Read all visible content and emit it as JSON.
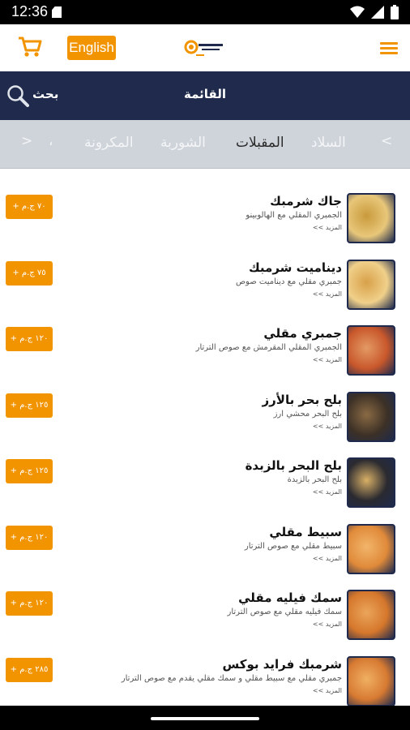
{
  "status": {
    "time": "12:36"
  },
  "header": {
    "language_label": "English",
    "logo_text": "شرمبكس"
  },
  "search": {
    "label": "بحث",
    "title": "القائمة"
  },
  "categories": {
    "left_arrow": ">",
    "right_arrow": "<",
    "dot": "،",
    "items": [
      "المكرونة",
      "الشوربة",
      "المقبلات",
      "السلاد"
    ],
    "active_index": 2
  },
  "menu_items": [
    {
      "name": "جاك شرمبك",
      "desc": "الجمبري المقلي مع الهالوبينو",
      "more": "المزيد >>",
      "price": "٧٠ ج.م +",
      "colors": [
        "#e8c77a",
        "#c99a3c"
      ]
    },
    {
      "name": "ديناميت شرمبك",
      "desc": "جمبري مقلي مع ديناميت صوص",
      "more": "المزيد >>",
      "price": "٧٥ ج.م +",
      "colors": [
        "#f0d08a",
        "#d8a14a"
      ]
    },
    {
      "name": "جمبري مقلي",
      "desc": "الجمبري المقلي المقرمش مع صوص الترتار",
      "more": "المزيد >>",
      "price": "١٢٠ ج.م +",
      "colors": [
        "#c9582c",
        "#e39a64"
      ]
    },
    {
      "name": "بلح بحر بالأرز",
      "desc": "بلح البحر محشي ارز",
      "more": "المزيد >>",
      "price": "١٢٥ ج.م +",
      "colors": [
        "#3d3126",
        "#8a6a44"
      ]
    },
    {
      "name": "بلح البحر بالزبدة",
      "desc": "بلح البحر بالزبدة",
      "more": "المزيد >>",
      "price": "١٢٥ ج.م +",
      "colors": [
        "#2a2a30",
        "#d9b066"
      ]
    },
    {
      "name": "سبيط مقلي",
      "desc": "سبيط مقلي مع صوص الترتار",
      "more": "المزيد >>",
      "price": "١٢٠ ج.م +",
      "colors": [
        "#e08a3a",
        "#f2b56a"
      ]
    },
    {
      "name": "سمك فيليه مقلي",
      "desc": "سمك فيليه مقلي مع صوص الترتار",
      "more": "المزيد >>",
      "price": "١٢٠ ج.م +",
      "colors": [
        "#d5772c",
        "#eaa55a"
      ]
    },
    {
      "name": "شرمبك فرايد بوكس",
      "desc": "جمبري مقلي مع سبيط مقلي و سمك مقلي يقدم مع صوص الترتار",
      "more": "المزيد >>",
      "price": "٢٨٥ ج.م +",
      "colors": [
        "#d77a32",
        "#f0b062"
      ]
    }
  ],
  "colors": {
    "accent": "#f29400",
    "navy": "#1f2a4d",
    "category_bg": "#cfd4db"
  }
}
